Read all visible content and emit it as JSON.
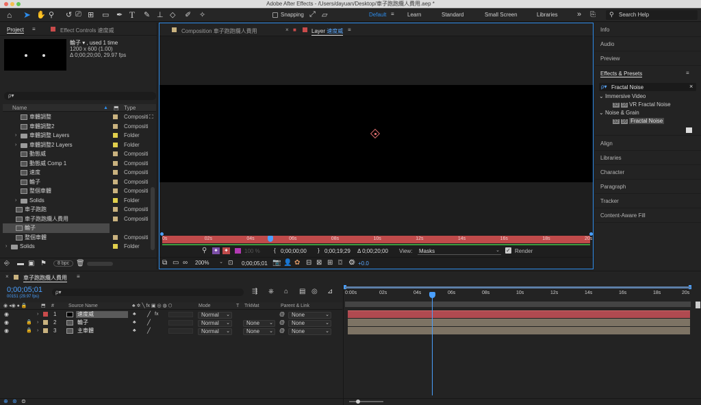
{
  "window": {
    "title": "Adobe After Effects - /Users/dayuan/Desktop/車子跑跑纜人費用.aep *"
  },
  "toolbar": {
    "snapping": "Snapping",
    "workspaces": [
      "Default",
      "Learn",
      "Standard",
      "Small Screen",
      "Libraries"
    ],
    "search_placeholder": "Search Help",
    "more": "»"
  },
  "project": {
    "tab": "Project",
    "effect_tab": "Effect Controls 速度威",
    "preview_name": "輪子 ▾ , used 1 time",
    "preview_size": "1200 x 600 (1.00)",
    "preview_dur": "Δ 0;00;20;00, 29.97 fps",
    "search_placeholder": "ρ▾",
    "col_name": "Name",
    "col_type": "Type",
    "items": [
      {
        "name": "車體調整",
        "type": "Compositi",
        "indent": 2,
        "kind": "comp",
        "label": "#c9b27f"
      },
      {
        "name": "車體調整2",
        "type": "Compositi",
        "indent": 2,
        "kind": "comp",
        "label": "#c9b27f"
      },
      {
        "name": "車體調整 Layers",
        "type": "Folder",
        "indent": 2,
        "kind": "folder",
        "label": "#e0cf4c",
        "tw": true
      },
      {
        "name": "車體調整2 Layers",
        "type": "Folder",
        "indent": 2,
        "kind": "folder",
        "label": "#e0cf4c",
        "tw": true
      },
      {
        "name": "動態威",
        "type": "Compositi",
        "indent": 2,
        "kind": "comp",
        "label": "#c9b27f"
      },
      {
        "name": "動態威 Comp 1",
        "type": "Compositi",
        "indent": 2,
        "kind": "comp",
        "label": "#c9b27f"
      },
      {
        "name": "速度",
        "type": "Compositi",
        "indent": 2,
        "kind": "comp",
        "label": "#c9b27f"
      },
      {
        "name": "輪子",
        "type": "Compositi",
        "indent": 2,
        "kind": "comp",
        "label": "#c9b27f"
      },
      {
        "name": "整個車體",
        "type": "Compositi",
        "indent": 2,
        "kind": "comp",
        "label": "#c9b27f"
      },
      {
        "name": "Solids",
        "type": "Folder",
        "indent": 2,
        "kind": "folder",
        "label": "#e0cf4c",
        "tw": true
      },
      {
        "name": "車子跑跑",
        "type": "Compositi",
        "indent": 1,
        "kind": "comp",
        "label": "#c9b27f"
      },
      {
        "name": "車子跑跑纜人費用",
        "type": "Compositi",
        "indent": 1,
        "kind": "comp",
        "label": "#c9b27f"
      },
      {
        "name": "輪子",
        "type": "Compositi",
        "indent": 1,
        "kind": "comp",
        "label": "#c9b27f",
        "selected": true
      },
      {
        "name": "整個車體",
        "type": "Compositi",
        "indent": 1,
        "kind": "comp",
        "label": "#c9b27f"
      },
      {
        "name": "Solids",
        "type": "Folder",
        "indent": 0,
        "kind": "folder",
        "label": "#e0cf4c",
        "tw": true
      }
    ],
    "bpc": "8 bpc"
  },
  "viewer": {
    "tab1": "Composition 車子跑跑纜人費用",
    "tab2_prefix": "Layer",
    "tab2_name": "速度威",
    "ticks": [
      "0s",
      "02s",
      "04s",
      "06s",
      "08s",
      "10s",
      "12s",
      "14s",
      "16s",
      "18s",
      "20s"
    ],
    "tc_in": "0;00;00;00",
    "tc_out": "0;00;19;29",
    "tc_dur": "Δ 0;00;20;00",
    "view_label": "View:",
    "view_value": "Masks",
    "render": "Render",
    "zoom": "200%",
    "timecode": "0;00;05;01",
    "exposure": "+0.0",
    "opacity": "100 %"
  },
  "panels": {
    "items": [
      "Info",
      "Audio",
      "Preview"
    ],
    "effects": "Effects & Presets",
    "search": "Fractal Noise",
    "cat1": "Immersive Video",
    "eff1": "VR Fractal Noise",
    "cat2": "Noise & Grain",
    "eff2": "Fractal Noise",
    "items2": [
      "Align",
      "Libraries",
      "Character",
      "Paragraph",
      "Tracker",
      "Content-Aware Fill"
    ]
  },
  "timeline": {
    "tab": "車子跑跑纜人費用",
    "timecode": "0;00;05;01",
    "frames": "00151 (29.97 fps)",
    "search_placeholder": "ρ▾",
    "cols": {
      "source": "Source Name",
      "mode": "Mode",
      "t": "T",
      "trkmat": "TrkMat",
      "parent": "Parent & Link"
    },
    "layers": [
      {
        "num": "1",
        "name": "速度威",
        "mode": "Normal",
        "trk": "",
        "parent": "None",
        "label": "#c94b4b",
        "bar": "#b04a50",
        "selected": true,
        "solid": true
      },
      {
        "num": "2",
        "name": "輪子",
        "mode": "Normal",
        "trk": "None",
        "parent": "None",
        "label": "#c9b27f",
        "bar": "#7d7364"
      },
      {
        "num": "3",
        "name": "主車體",
        "mode": "Normal",
        "trk": "None",
        "parent": "None",
        "label": "#c9b27f",
        "bar": "#7d7364"
      }
    ],
    "ticks": [
      "0:00s",
      "02s",
      "04s",
      "06s",
      "08s",
      "10s",
      "12s",
      "14s",
      "16s",
      "18s",
      "20s"
    ]
  },
  "colors": {
    "accent": "#2d8ceb",
    "work_red": "#c04a4a"
  }
}
